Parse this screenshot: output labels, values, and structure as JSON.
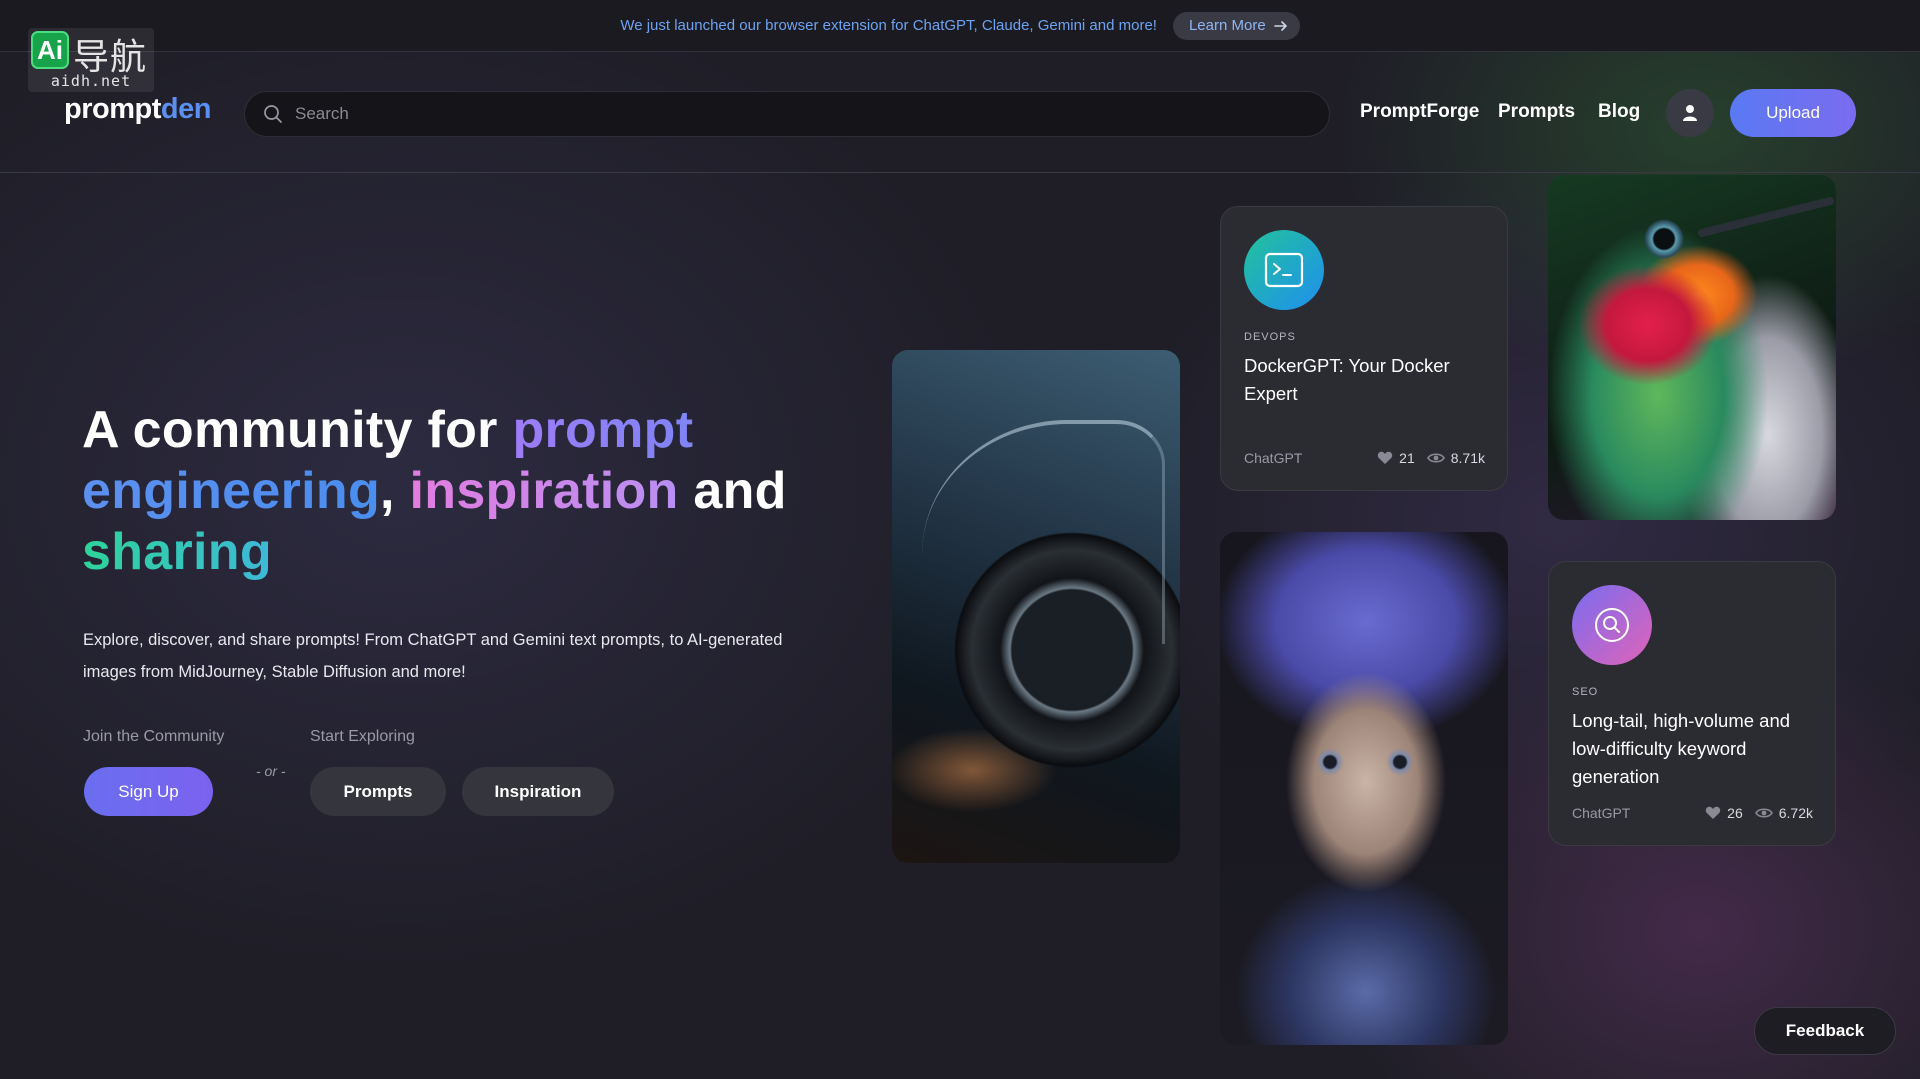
{
  "announcement": {
    "text": "We just launched our browser extension for ChatGPT, Claude, Gemini and more!",
    "button_label": "Learn More"
  },
  "watermark": {
    "badge": "Ai",
    "cn": "导航",
    "domain": "aidh.net"
  },
  "header": {
    "brand_part1": "prompt",
    "brand_part2": "den",
    "search_placeholder": "Search",
    "nav": [
      "PromptForge",
      "Prompts",
      "Blog"
    ],
    "upload_label": "Upload"
  },
  "hero": {
    "title_1": "A community for ",
    "title_prompt": "prompt",
    "title_engineering": "engineering",
    "title_comma": ", ",
    "title_inspiration": "inspiration",
    "title_and": " and",
    "title_sharing": "sharing",
    "description": "Explore, discover, and share prompts! From ChatGPT and Gemini text prompts, to AI-generated images from MidJourney, Stable Diffusion and more!",
    "join_label": "Join the Community",
    "explore_label": "Start Exploring",
    "or_text": "- or -",
    "signup_label": "Sign Up",
    "prompts_label": "Prompts",
    "inspiration_label": "Inspiration"
  },
  "cards": [
    {
      "category": "DEVOPS",
      "title": "DockerGPT: Your Docker Expert",
      "model": "ChatGPT",
      "likes": "21",
      "views": "8.71k",
      "icon": "terminal-icon"
    },
    {
      "category": "SEO",
      "title": "Long-tail, high-volume and low-difficulty keyword generation",
      "model": "ChatGPT",
      "likes": "26",
      "views": "6.72k",
      "icon": "search-icon"
    }
  ],
  "feedback_label": "Feedback",
  "colors": {
    "accent_blue": "#5b8ff0",
    "accent_purple": "#7b62ee",
    "background": "#1f1e27"
  }
}
